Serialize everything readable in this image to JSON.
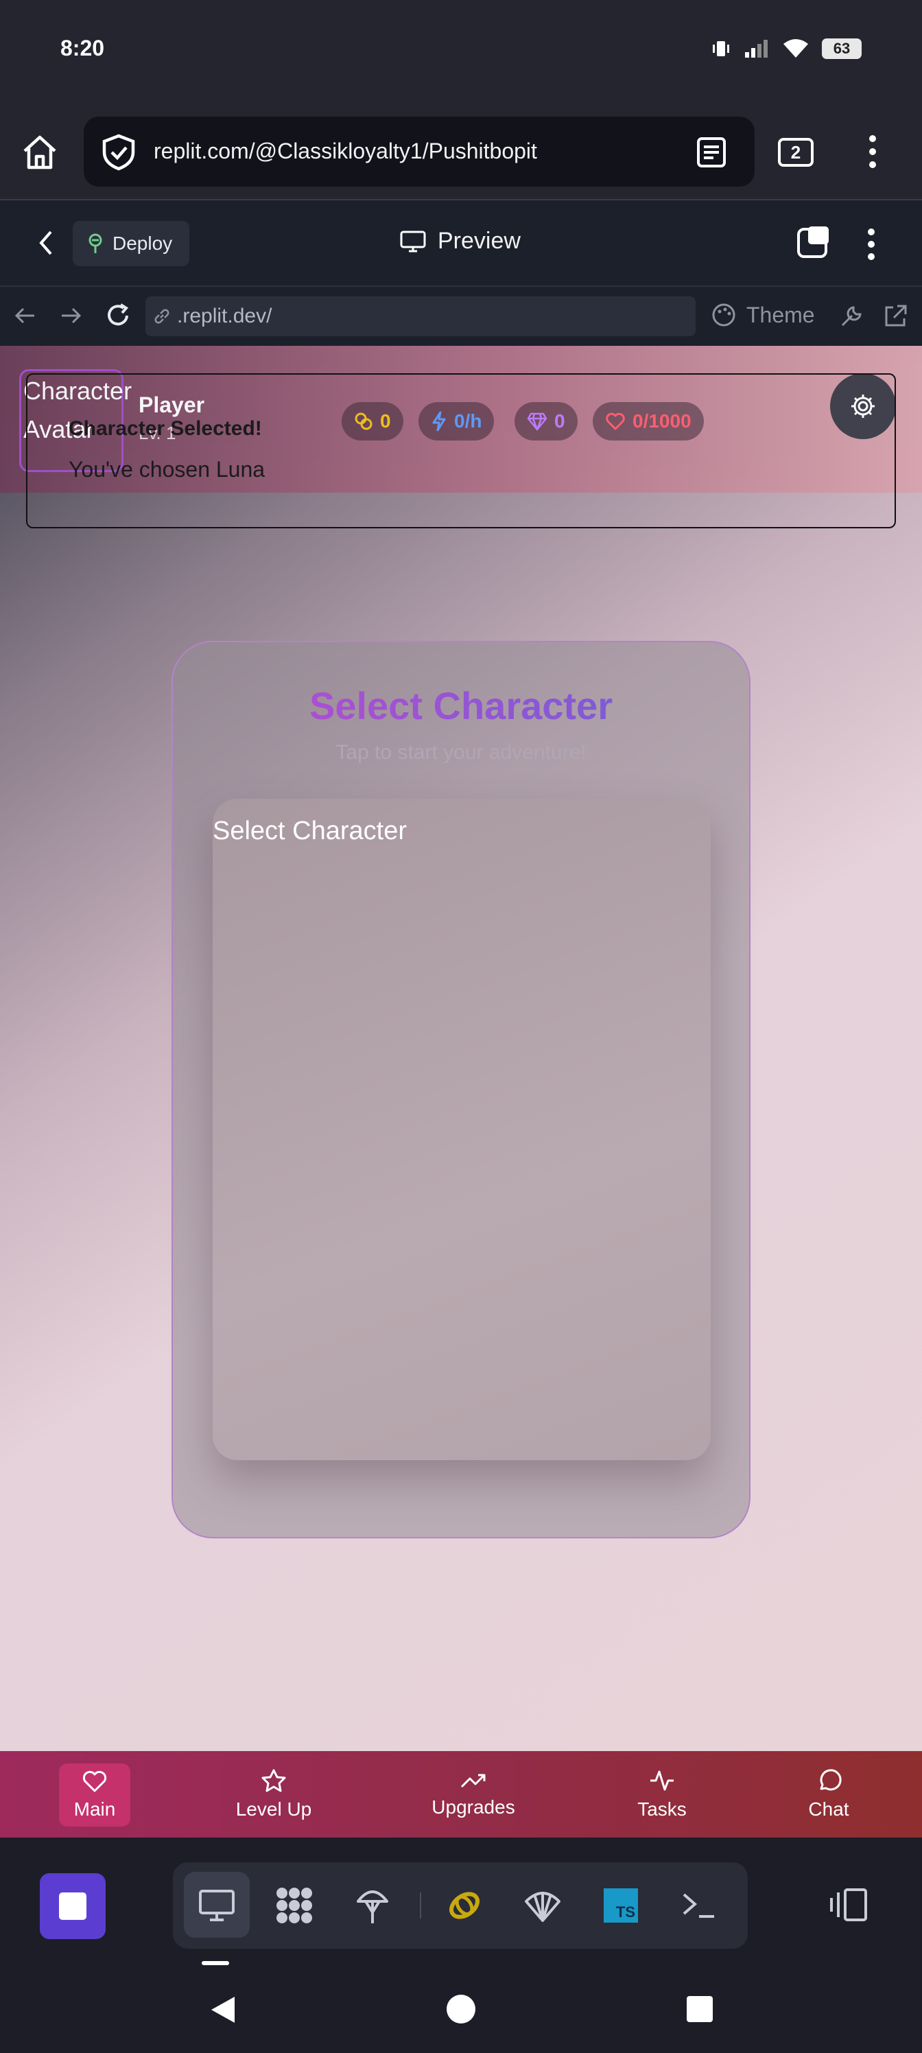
{
  "status_bar": {
    "time": "8:20",
    "battery": "63"
  },
  "browser": {
    "url": "replit.com/@Classikloyalty1/Pushitbopit",
    "tab_count": "2"
  },
  "replit_header": {
    "deploy_label": "Deploy",
    "preview_label": "Preview"
  },
  "nav_row": {
    "address": ".replit.dev/",
    "theme_label": "Theme"
  },
  "game": {
    "avatar_label": "Character Avatar",
    "player_name": "Player",
    "player_level": "Lv. 1",
    "stats": {
      "coins": "0",
      "energy_rate": "0/h",
      "gems": "0",
      "hearts": "0/1000"
    },
    "toast": {
      "title": "Character Selected!",
      "message": "You've chosen Luna"
    },
    "card": {
      "title": "Select Character",
      "subtitle": "Tap to start your adventure!",
      "inner_title": "Select Character"
    }
  },
  "tabs": [
    {
      "label": "Main"
    },
    {
      "label": "Level Up"
    },
    {
      "label": "Upgrades"
    },
    {
      "label": "Tasks"
    },
    {
      "label": "Chat"
    }
  ],
  "colors": {
    "accent_purple": "#5b3ed1",
    "tab_active": "#c4316b",
    "coin": "#f4c21a",
    "energy": "#5b9bff",
    "gem": "#c07bff",
    "heart": "#ff5d6e"
  }
}
